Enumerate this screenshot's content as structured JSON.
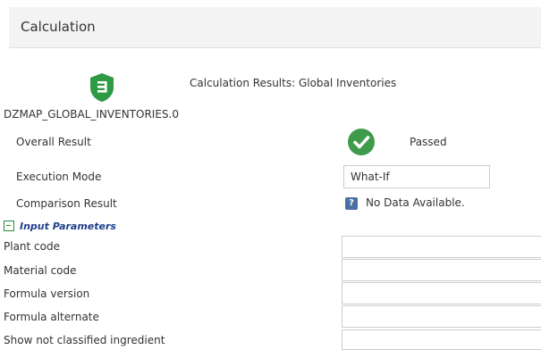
{
  "header": {
    "title": "Calculation"
  },
  "results": {
    "title": "Calculation Results: Global Inventories",
    "calc_id": "DZMAP_GLOBAL_INVENTORIES.0"
  },
  "overall": {
    "label": "Overall Result",
    "status": "Passed"
  },
  "execution": {
    "label": "Execution Mode",
    "value": "What-If"
  },
  "comparison": {
    "label": "Comparison Result",
    "value": "No Data Available."
  },
  "input_parameters": {
    "title": "Input Parameters",
    "fields": [
      {
        "label": "Plant code",
        "value": ""
      },
      {
        "label": "Material code",
        "value": ""
      },
      {
        "label": "Formula version",
        "value": ""
      },
      {
        "label": "Formula alternate",
        "value": ""
      },
      {
        "label": "Show not classified ingredient",
        "value": ""
      }
    ]
  },
  "colors": {
    "shield": "#2e9a45",
    "check": "#3f9a4c",
    "section_title": "#1f3f8a",
    "info_icon": "#4a6fa5"
  },
  "icons": {
    "shield": "shield-icon",
    "check": "check-circle-icon",
    "info": "question-icon",
    "collapse": "collapse-icon"
  }
}
